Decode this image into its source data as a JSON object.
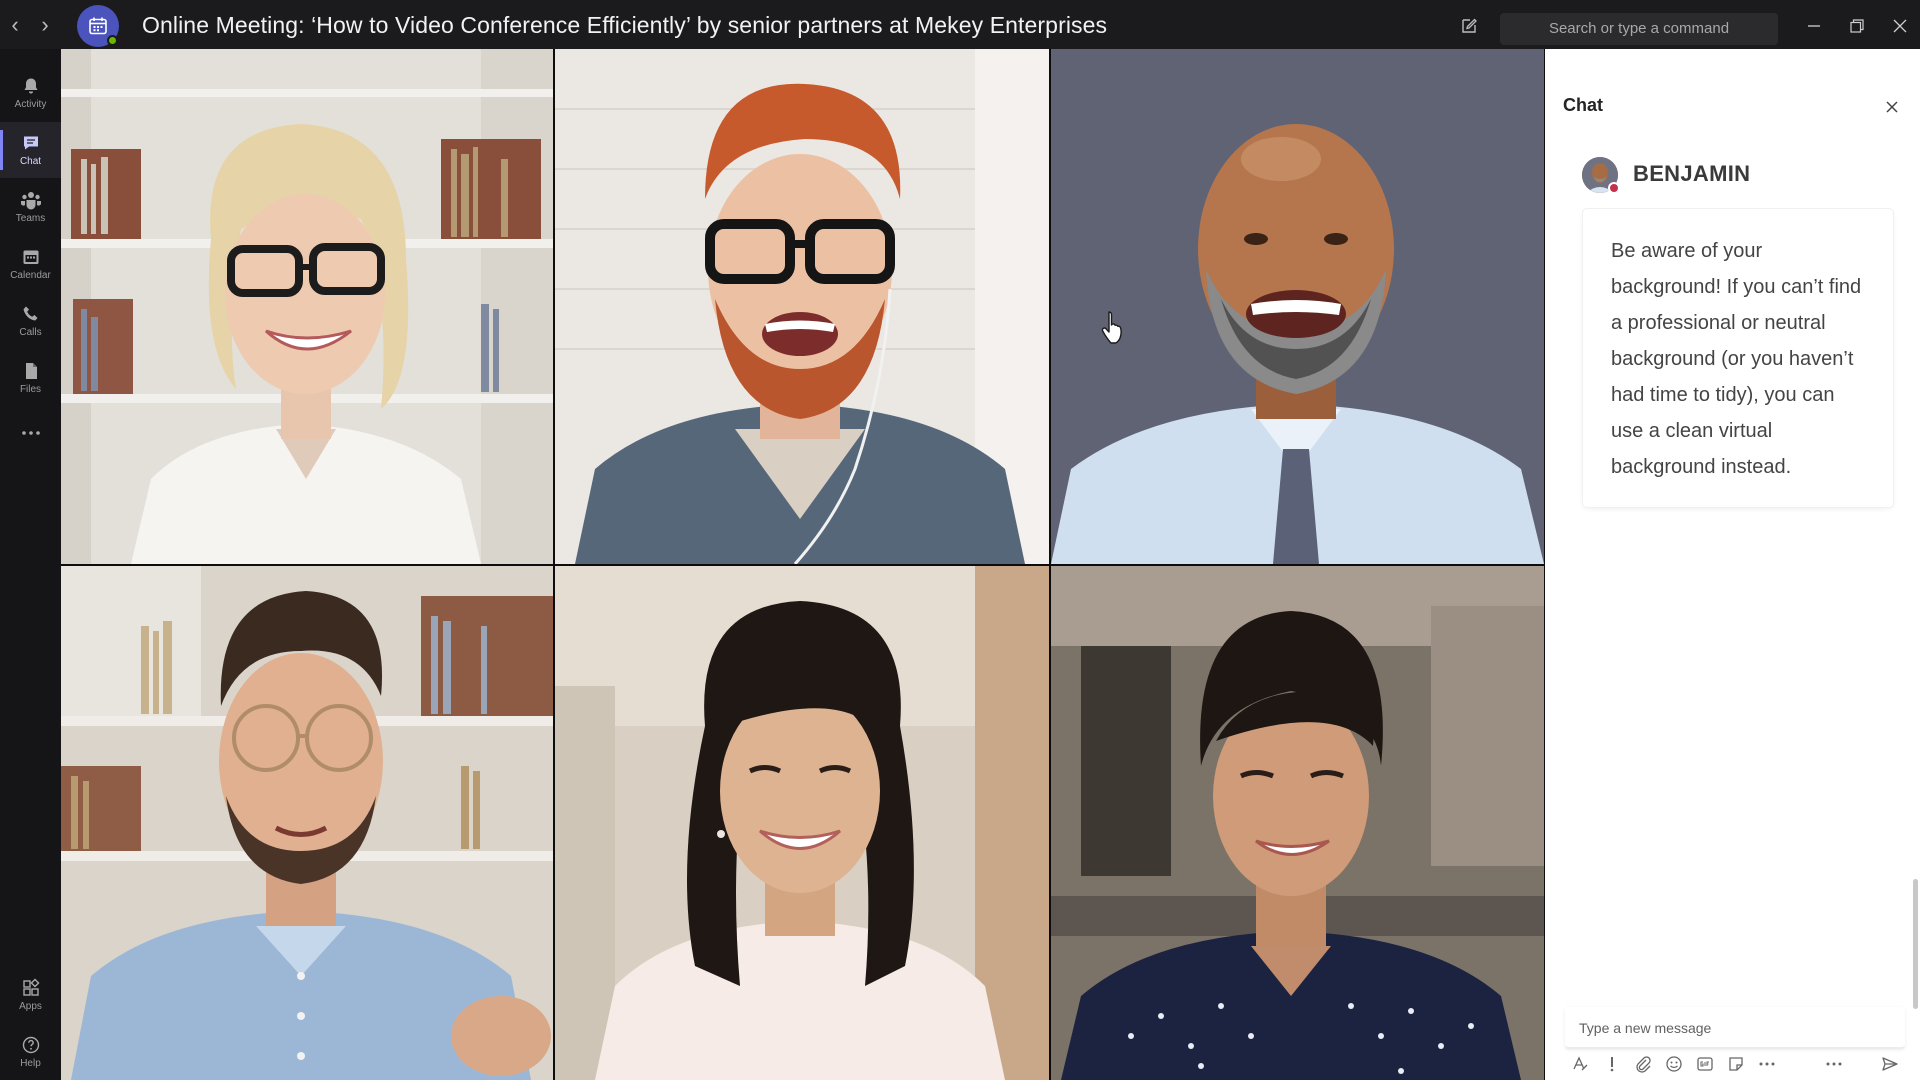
{
  "window": {
    "title": "Online Meeting: ‘How to Video Conference Efficiently’ by senior partners at Mekey Enterprises",
    "search_placeholder": "Search or type a command"
  },
  "left_rail": {
    "items": [
      {
        "label": "Activity",
        "icon": "bell-icon"
      },
      {
        "label": "Chat",
        "icon": "chat-icon",
        "active": true
      },
      {
        "label": "Teams",
        "icon": "teams-icon"
      },
      {
        "label": "Calendar",
        "icon": "calendar-icon"
      },
      {
        "label": "Calls",
        "icon": "phone-icon"
      },
      {
        "label": "Files",
        "icon": "file-icon"
      }
    ],
    "bottom": [
      {
        "label": "Apps",
        "icon": "apps-icon"
      },
      {
        "label": "Help",
        "icon": "help-icon"
      }
    ]
  },
  "video_grid": {
    "participants": [
      {
        "tile": 1,
        "bg": "#e4e1db"
      },
      {
        "tile": 2,
        "bg": "#e9e5e1"
      },
      {
        "tile": 3,
        "bg": "#5f6272"
      },
      {
        "tile": 4,
        "bg": "#d9d3c9"
      },
      {
        "tile": 5,
        "bg": "#d8cfc4"
      },
      {
        "tile": 6,
        "bg": "#7a7268"
      }
    ]
  },
  "chat": {
    "header": "Chat",
    "sender": "BENJAMIN",
    "message": "Be aware of your background! If you can’t find a professional or neutral background (or you haven’t had time to tidy), you can use a clean virtual background instead.",
    "compose_placeholder": "Type a new message"
  },
  "colors": {
    "accent": "#4b53bc",
    "rail_active": "#7f85f5",
    "presence_busy": "#c4314b",
    "presence_available": "#6bb700"
  }
}
